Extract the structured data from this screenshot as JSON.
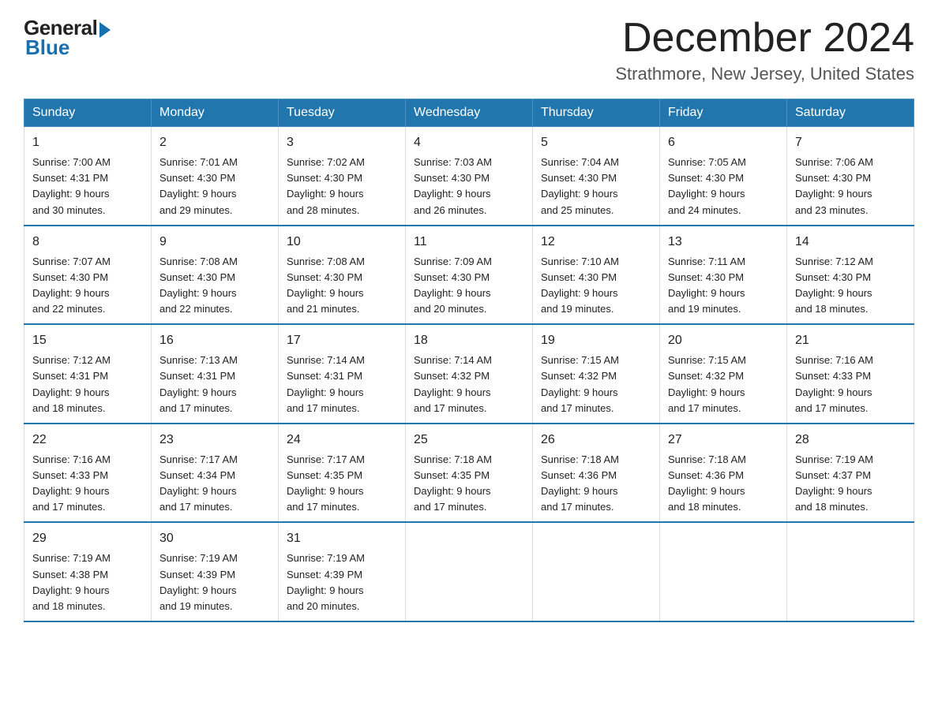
{
  "header": {
    "logo_general": "General",
    "logo_blue": "Blue",
    "month_title": "December 2024",
    "location": "Strathmore, New Jersey, United States"
  },
  "days_of_week": [
    "Sunday",
    "Monday",
    "Tuesday",
    "Wednesday",
    "Thursday",
    "Friday",
    "Saturday"
  ],
  "weeks": [
    [
      {
        "day": "1",
        "sunrise": "7:00 AM",
        "sunset": "4:31 PM",
        "daylight": "9 hours and 30 minutes."
      },
      {
        "day": "2",
        "sunrise": "7:01 AM",
        "sunset": "4:30 PM",
        "daylight": "9 hours and 29 minutes."
      },
      {
        "day": "3",
        "sunrise": "7:02 AM",
        "sunset": "4:30 PM",
        "daylight": "9 hours and 28 minutes."
      },
      {
        "day": "4",
        "sunrise": "7:03 AM",
        "sunset": "4:30 PM",
        "daylight": "9 hours and 26 minutes."
      },
      {
        "day": "5",
        "sunrise": "7:04 AM",
        "sunset": "4:30 PM",
        "daylight": "9 hours and 25 minutes."
      },
      {
        "day": "6",
        "sunrise": "7:05 AM",
        "sunset": "4:30 PM",
        "daylight": "9 hours and 24 minutes."
      },
      {
        "day": "7",
        "sunrise": "7:06 AM",
        "sunset": "4:30 PM",
        "daylight": "9 hours and 23 minutes."
      }
    ],
    [
      {
        "day": "8",
        "sunrise": "7:07 AM",
        "sunset": "4:30 PM",
        "daylight": "9 hours and 22 minutes."
      },
      {
        "day": "9",
        "sunrise": "7:08 AM",
        "sunset": "4:30 PM",
        "daylight": "9 hours and 22 minutes."
      },
      {
        "day": "10",
        "sunrise": "7:08 AM",
        "sunset": "4:30 PM",
        "daylight": "9 hours and 21 minutes."
      },
      {
        "day": "11",
        "sunrise": "7:09 AM",
        "sunset": "4:30 PM",
        "daylight": "9 hours and 20 minutes."
      },
      {
        "day": "12",
        "sunrise": "7:10 AM",
        "sunset": "4:30 PM",
        "daylight": "9 hours and 19 minutes."
      },
      {
        "day": "13",
        "sunrise": "7:11 AM",
        "sunset": "4:30 PM",
        "daylight": "9 hours and 19 minutes."
      },
      {
        "day": "14",
        "sunrise": "7:12 AM",
        "sunset": "4:30 PM",
        "daylight": "9 hours and 18 minutes."
      }
    ],
    [
      {
        "day": "15",
        "sunrise": "7:12 AM",
        "sunset": "4:31 PM",
        "daylight": "9 hours and 18 minutes."
      },
      {
        "day": "16",
        "sunrise": "7:13 AM",
        "sunset": "4:31 PM",
        "daylight": "9 hours and 17 minutes."
      },
      {
        "day": "17",
        "sunrise": "7:14 AM",
        "sunset": "4:31 PM",
        "daylight": "9 hours and 17 minutes."
      },
      {
        "day": "18",
        "sunrise": "7:14 AM",
        "sunset": "4:32 PM",
        "daylight": "9 hours and 17 minutes."
      },
      {
        "day": "19",
        "sunrise": "7:15 AM",
        "sunset": "4:32 PM",
        "daylight": "9 hours and 17 minutes."
      },
      {
        "day": "20",
        "sunrise": "7:15 AM",
        "sunset": "4:32 PM",
        "daylight": "9 hours and 17 minutes."
      },
      {
        "day": "21",
        "sunrise": "7:16 AM",
        "sunset": "4:33 PM",
        "daylight": "9 hours and 17 minutes."
      }
    ],
    [
      {
        "day": "22",
        "sunrise": "7:16 AM",
        "sunset": "4:33 PM",
        "daylight": "9 hours and 17 minutes."
      },
      {
        "day": "23",
        "sunrise": "7:17 AM",
        "sunset": "4:34 PM",
        "daylight": "9 hours and 17 minutes."
      },
      {
        "day": "24",
        "sunrise": "7:17 AM",
        "sunset": "4:35 PM",
        "daylight": "9 hours and 17 minutes."
      },
      {
        "day": "25",
        "sunrise": "7:18 AM",
        "sunset": "4:35 PM",
        "daylight": "9 hours and 17 minutes."
      },
      {
        "day": "26",
        "sunrise": "7:18 AM",
        "sunset": "4:36 PM",
        "daylight": "9 hours and 17 minutes."
      },
      {
        "day": "27",
        "sunrise": "7:18 AM",
        "sunset": "4:36 PM",
        "daylight": "9 hours and 18 minutes."
      },
      {
        "day": "28",
        "sunrise": "7:19 AM",
        "sunset": "4:37 PM",
        "daylight": "9 hours and 18 minutes."
      }
    ],
    [
      {
        "day": "29",
        "sunrise": "7:19 AM",
        "sunset": "4:38 PM",
        "daylight": "9 hours and 18 minutes."
      },
      {
        "day": "30",
        "sunrise": "7:19 AM",
        "sunset": "4:39 PM",
        "daylight": "9 hours and 19 minutes."
      },
      {
        "day": "31",
        "sunrise": "7:19 AM",
        "sunset": "4:39 PM",
        "daylight": "9 hours and 20 minutes."
      },
      null,
      null,
      null,
      null
    ]
  ],
  "labels": {
    "sunrise": "Sunrise:",
    "sunset": "Sunset:",
    "daylight": "Daylight:"
  }
}
